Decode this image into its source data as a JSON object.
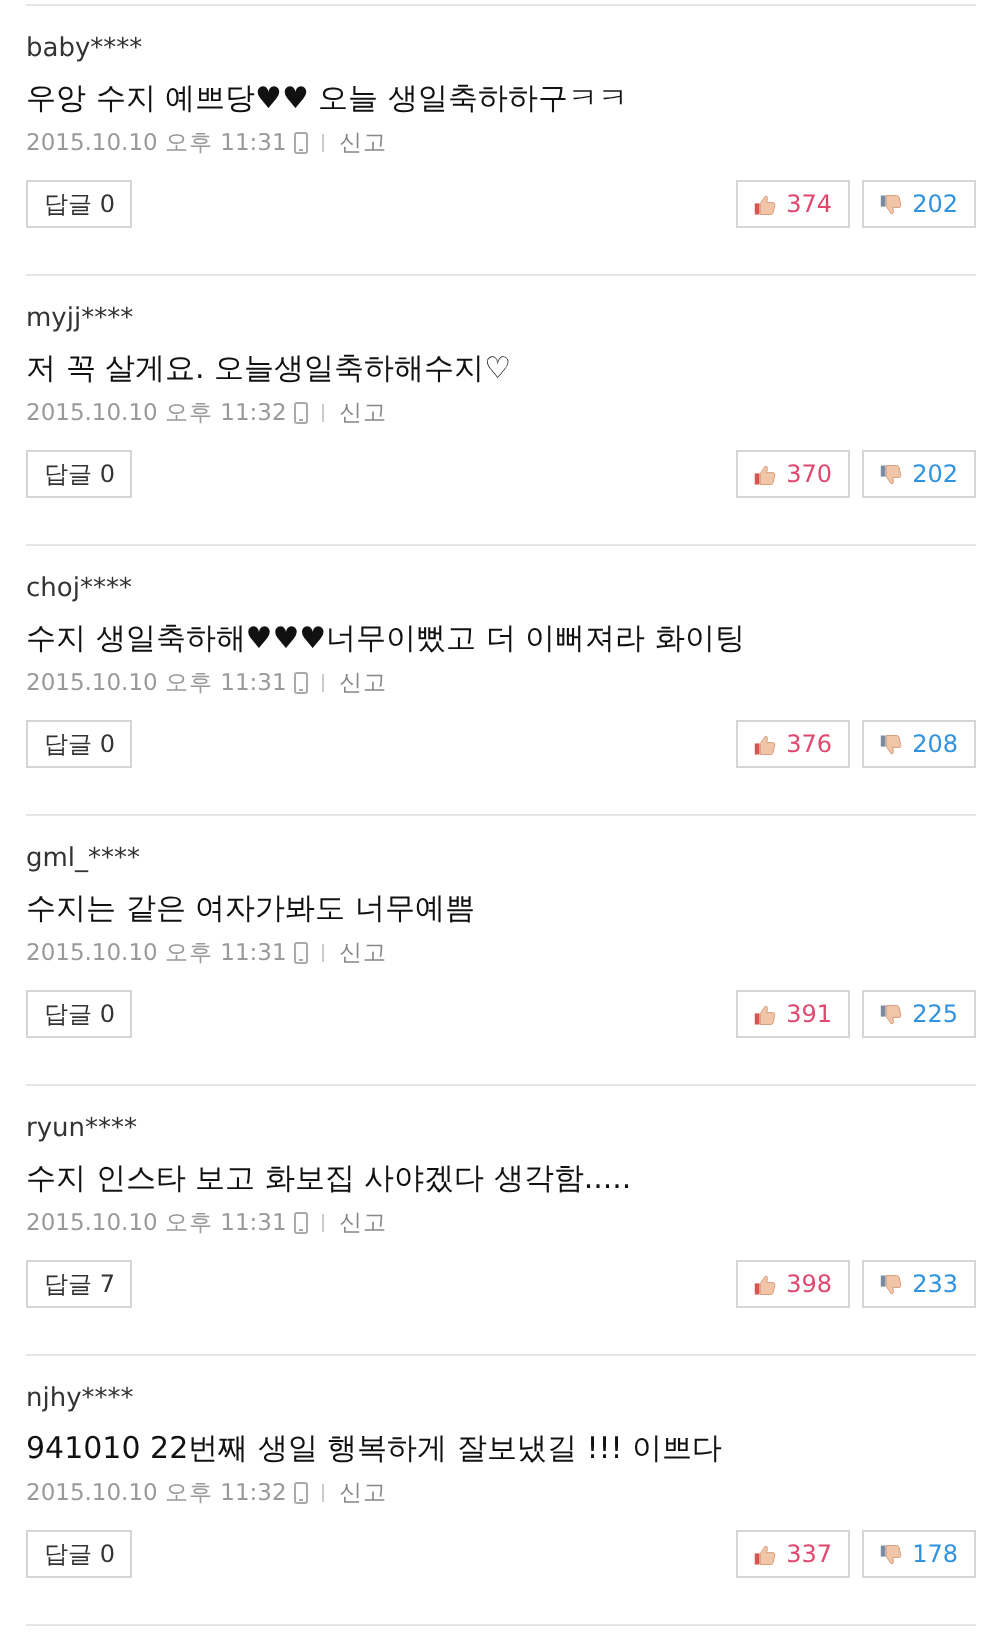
{
  "comments": [
    {
      "user": "baby****",
      "text": "우앙 수지 예쁘당♥♥ 오늘 생일축하하구ㅋㅋ",
      "date": "2015.10.10 오후 11:31",
      "report": "신고",
      "reply": "답글 0",
      "likes": "374",
      "dislikes": "202"
    },
    {
      "user": "myjj****",
      "text": "저 꼭 살게요. 오늘생일축하해수지♡",
      "date": "2015.10.10 오후 11:32",
      "report": "신고",
      "reply": "답글 0",
      "likes": "370",
      "dislikes": "202"
    },
    {
      "user": "choj****",
      "text": "수지 생일축하해♥♥♥너무이뻤고 더 이뻐져라 화이팅",
      "date": "2015.10.10 오후 11:31",
      "report": "신고",
      "reply": "답글 0",
      "likes": "376",
      "dislikes": "208"
    },
    {
      "user": "gml_****",
      "text": "수지는 같은 여자가봐도 너무예쁨",
      "date": "2015.10.10 오후 11:31",
      "report": "신고",
      "reply": "답글 0",
      "likes": "391",
      "dislikes": "225"
    },
    {
      "user": "ryun****",
      "text": "수지 인스타 보고 화보집 사야겠다 생각함.....",
      "date": "2015.10.10 오후 11:31",
      "report": "신고",
      "reply": "답글 7",
      "likes": "398",
      "dislikes": "233"
    },
    {
      "user": "njhy****",
      "text": "941010 22번째 생일 행복하게 잘보냈길 !!! 이쁘다",
      "date": "2015.10.10 오후 11:32",
      "report": "신고",
      "reply": "답글 0",
      "likes": "337",
      "dislikes": "178"
    }
  ]
}
